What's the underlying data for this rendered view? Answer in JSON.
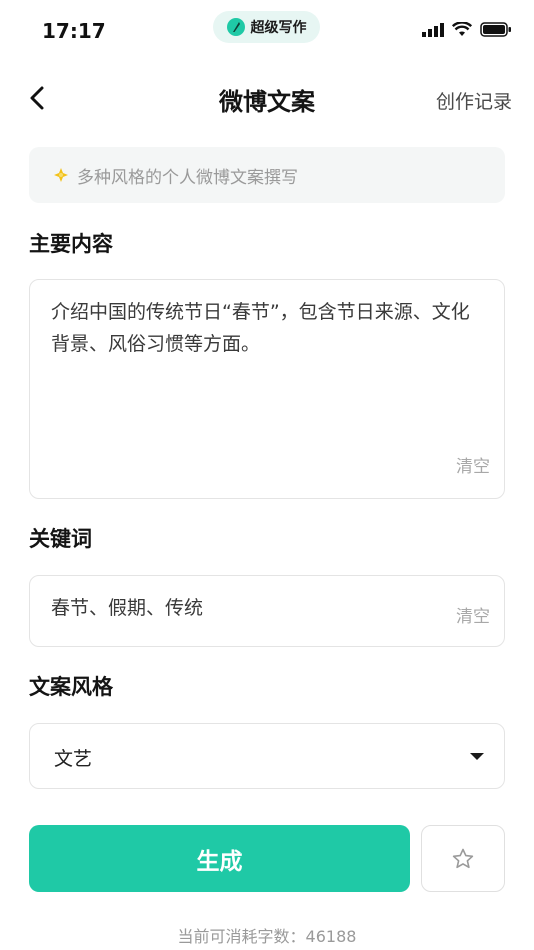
{
  "status_bar": {
    "time": "17:17",
    "app_name": "超级写作"
  },
  "nav": {
    "title": "微博文案",
    "right_link": "创作记录"
  },
  "notice": {
    "text": "多种风格的个人微博文案撰写"
  },
  "content": {
    "label": "主要内容",
    "value": "介绍中国的传统节日“春节”，包含节日来源、文化背景、风俗习惯等方面。",
    "clear_label": "清空"
  },
  "keywords": {
    "label": "关键词",
    "value": "春节、假期、传统",
    "clear_label": "清空"
  },
  "style": {
    "label": "文案风格",
    "selected": "文艺"
  },
  "actions": {
    "generate_label": "生成"
  },
  "footer": {
    "text": "当前可消耗字数：46188"
  },
  "colors": {
    "accent": "#1fc9a6",
    "pill_bg": "#e7f6f3",
    "notice_bg": "#f4f6f6"
  }
}
